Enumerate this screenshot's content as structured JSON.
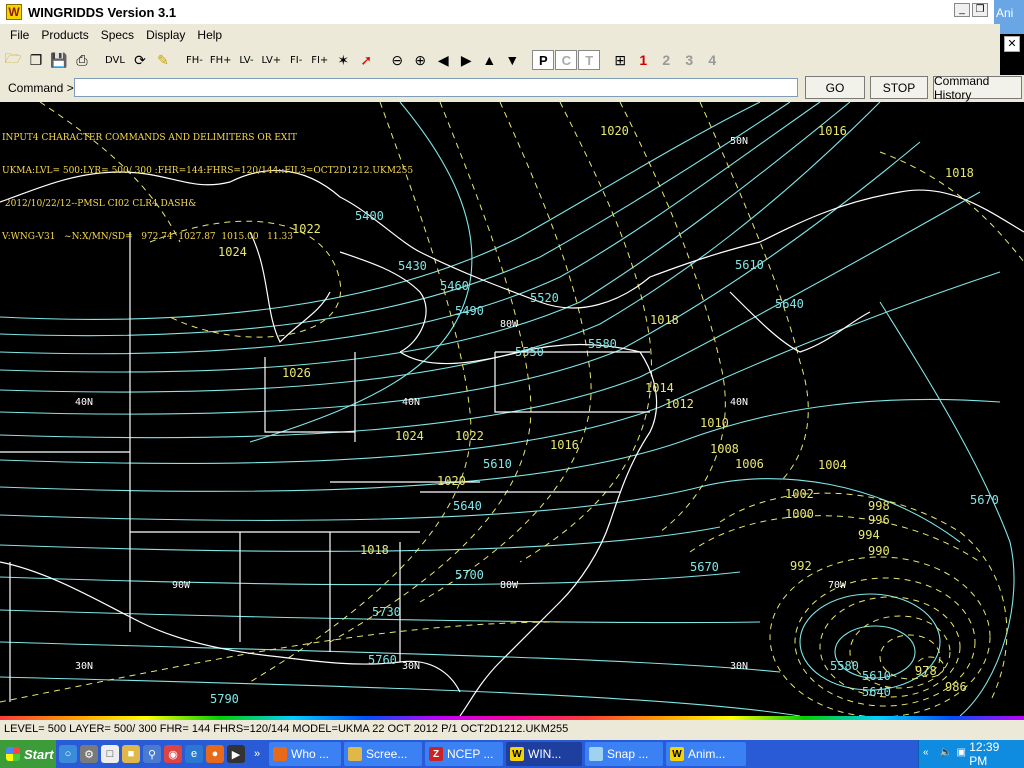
{
  "window": {
    "title": "WINGRIDDS Version 3.1",
    "icon_letter": "W",
    "bg_app_label": "Ani",
    "buttons": {
      "minimize": "_",
      "restore": "❐",
      "close": "✕"
    }
  },
  "menu": [
    "File",
    "Products",
    "Specs",
    "Display",
    "Help"
  ],
  "toolbar": {
    "text_buttons": [
      "DVL",
      "FH-",
      "FH+",
      "LV-",
      "LV+",
      "FI-",
      "FI+"
    ],
    "view_boxes": [
      "P",
      "C",
      "T"
    ],
    "frame_numbers": [
      "1",
      "2",
      "3",
      "4"
    ]
  },
  "command": {
    "label": "Command >",
    "value": "",
    "go": "GO",
    "stop": "STOP",
    "history": "Command History"
  },
  "map": {
    "info_lines": [
      "INPUT4 CHARACTER COMMANDS AND DELIMITERS OR EXIT",
      "UKMA:LVL= 500:LYR= 500/ 300 :FHR=144:FHRS=120/144::FIL3=OCT2D1212.UKM255",
      " 2012/10/22/12--PMSL CI02 CLR4 DASH&",
      "V:WNG-V31   ~N:X/MN/SD=   972.74  1027.87  1015.00   11.33"
    ],
    "height_labels": [
      {
        "t": "5400"
      },
      {
        "t": "5430"
      },
      {
        "t": "5460"
      },
      {
        "t": "5490"
      },
      {
        "t": "5520"
      },
      {
        "t": "5550"
      },
      {
        "t": "5580"
      },
      {
        "t": "5610"
      },
      {
        "t": "5610"
      },
      {
        "t": "5640"
      },
      {
        "t": "5640"
      },
      {
        "t": "5670"
      },
      {
        "t": "5670"
      },
      {
        "t": "5700"
      },
      {
        "t": "5730"
      },
      {
        "t": "5760"
      },
      {
        "t": "5790"
      },
      {
        "t": "5580"
      },
      {
        "t": "5610"
      },
      {
        "t": "5640"
      }
    ],
    "pressure_labels": [
      {
        "t": "1020"
      },
      {
        "t": "1016"
      },
      {
        "t": "1018"
      },
      {
        "t": "1022"
      },
      {
        "t": "1024"
      },
      {
        "t": "1018"
      },
      {
        "t": "1026"
      },
      {
        "t": "1014"
      },
      {
        "t": "1012"
      },
      {
        "t": "1010"
      },
      {
        "t": "1024"
      },
      {
        "t": "1022"
      },
      {
        "t": "1016"
      },
      {
        "t": "1008"
      },
      {
        "t": "1006"
      },
      {
        "t": "1004"
      },
      {
        "t": "1020"
      },
      {
        "t": "1002"
      },
      {
        "t": "1000"
      },
      {
        "t": "998"
      },
      {
        "t": "996"
      },
      {
        "t": "994"
      },
      {
        "t": "990"
      },
      {
        "t": "992"
      },
      {
        "t": "1018"
      },
      {
        "t": "978"
      },
      {
        "t": "986"
      }
    ],
    "lat_lon_labels": [
      {
        "t": "50N"
      },
      {
        "t": "80W"
      },
      {
        "t": "40N"
      },
      {
        "t": "40N"
      },
      {
        "t": "40N"
      },
      {
        "t": "90W"
      },
      {
        "t": "80W"
      },
      {
        "t": "70W"
      },
      {
        "t": "30N"
      },
      {
        "t": "30N"
      },
      {
        "t": "30N"
      }
    ]
  },
  "status": "LEVEL= 500 LAYER= 500/ 300 FHR= 144 FHRS=120/144 MODEL=UKMA  22 OCT 2012 P/1 OCT2D1212.UKM255",
  "taskbar": {
    "start": "Start",
    "tasks": [
      {
        "label": "Who ...",
        "icon": "firefox-icon"
      },
      {
        "label": "Scree...",
        "icon": "folder-icon"
      },
      {
        "label": "NCEP ...",
        "icon": "filezilla-icon"
      },
      {
        "label": "WIN...",
        "icon": "wingridds-icon",
        "active": true
      },
      {
        "label": "Snap ...",
        "icon": "snap-icon"
      },
      {
        "label": "Anim...",
        "icon": "wingridds-icon"
      }
    ],
    "time": "12:39 PM"
  }
}
